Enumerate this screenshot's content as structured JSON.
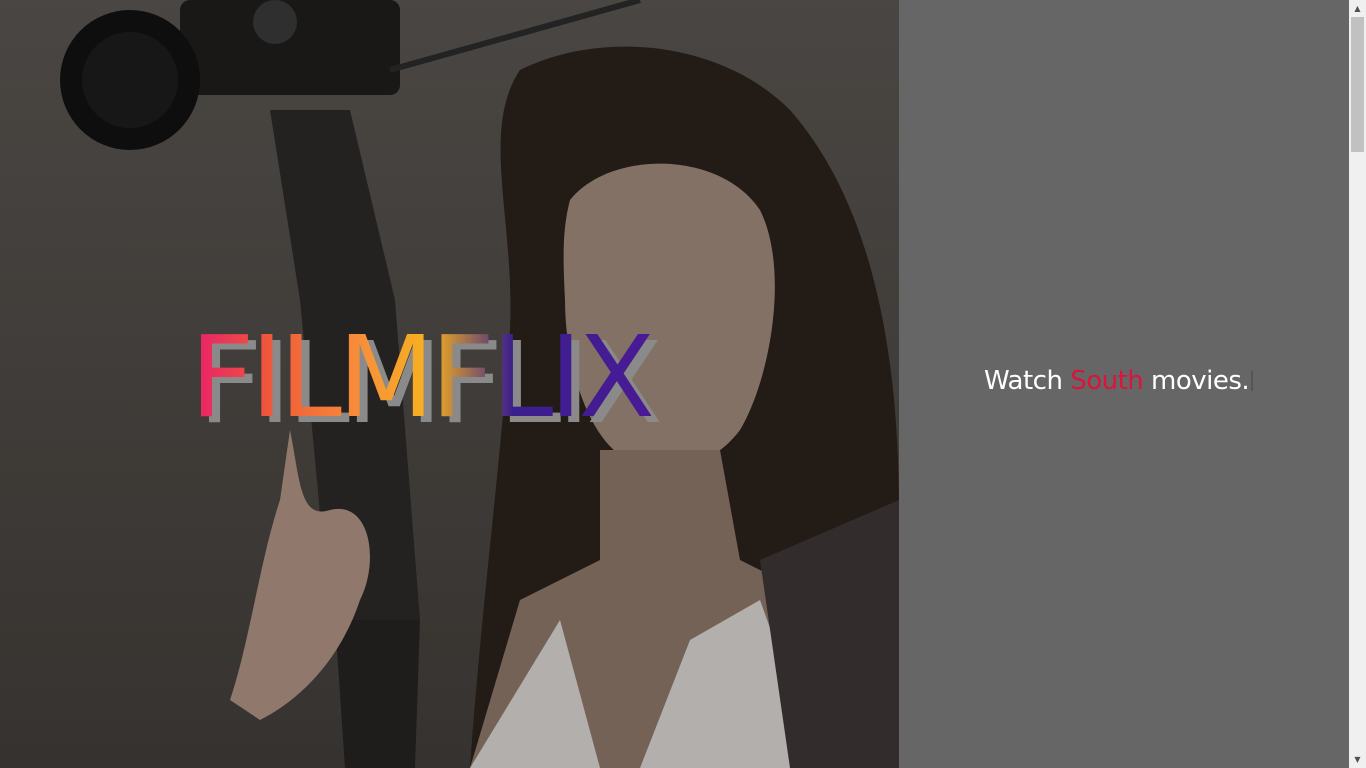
{
  "hero": {
    "image_alt": "Woman holding a camera rig"
  },
  "brand": {
    "name": "FILMFLIX"
  },
  "tagline": {
    "prefix": "Watch",
    "highlight": "South",
    "suffix": "movies."
  },
  "colors": {
    "highlight": "#dc143c",
    "background": "#666666",
    "logo_gradient": [
      "#e8206a",
      "#f7913a",
      "#f6b21f",
      "#4a1a96"
    ]
  },
  "scrollbar": {
    "up_icon": "triangle-up-icon",
    "down_icon": "triangle-down-icon"
  }
}
